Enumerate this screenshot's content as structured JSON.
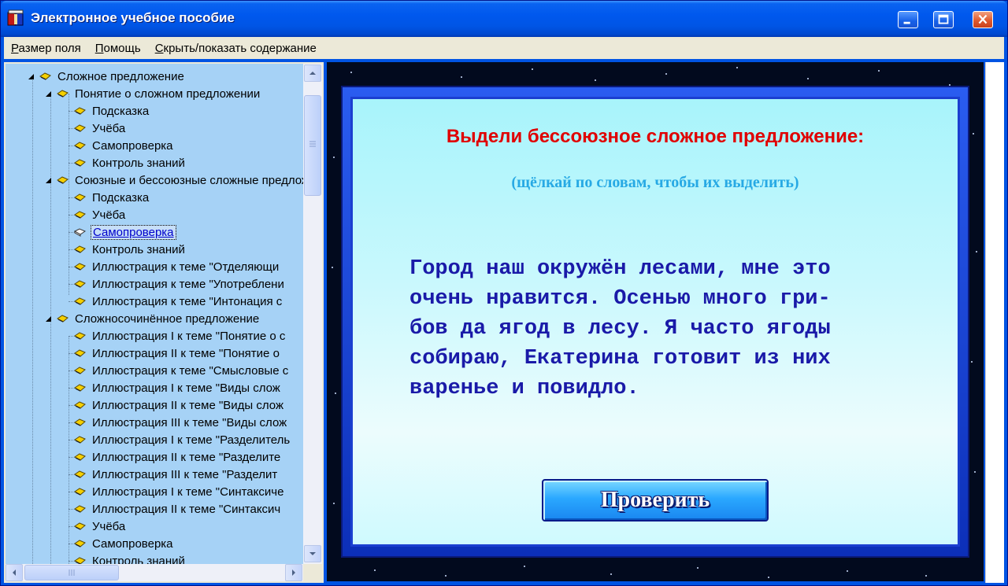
{
  "window": {
    "title": "Электронное учебное пособие",
    "app_icon": "book-app-icon",
    "controls": [
      "minimize-icon",
      "maximize-icon",
      "close-icon"
    ]
  },
  "menu": {
    "items": [
      "Размер поля",
      "Помощь",
      "Скрыть/показать содержание"
    ]
  },
  "tree": {
    "items": [
      {
        "label": "Сложное предложение",
        "level": 0,
        "expanded": true,
        "icon": "chapter-icon"
      },
      {
        "label": "Понятие о сложном предложении",
        "level": 1,
        "expanded": true,
        "icon": "chapter-icon"
      },
      {
        "label": "Подсказка",
        "level": 2,
        "icon": "page-icon"
      },
      {
        "label": "Учёба",
        "level": 2,
        "icon": "page-icon"
      },
      {
        "label": "Самопроверка",
        "level": 2,
        "icon": "page-icon"
      },
      {
        "label": "Контроль знаний",
        "level": 2,
        "icon": "page-icon"
      },
      {
        "label": "Союзные и бессоюзные сложные предложения",
        "level": 1,
        "expanded": true,
        "icon": "chapter-icon"
      },
      {
        "label": "Подсказка",
        "level": 2,
        "icon": "page-icon"
      },
      {
        "label": "Учёба",
        "level": 2,
        "icon": "page-icon"
      },
      {
        "label": "Самопроверка",
        "level": 2,
        "icon": "open-page-icon",
        "selected": true
      },
      {
        "label": "Контроль знаний",
        "level": 2,
        "icon": "page-icon"
      },
      {
        "label": "Иллюстрация к теме \"Отделяющи",
        "level": 2,
        "icon": "page-icon"
      },
      {
        "label": "Иллюстрация к теме \"Употреблени",
        "level": 2,
        "icon": "page-icon"
      },
      {
        "label": "Иллюстрация к теме \"Интонация с",
        "level": 2,
        "icon": "page-icon"
      },
      {
        "label": "Сложносочинённое предложение",
        "level": 1,
        "expanded": true,
        "icon": "chapter-icon"
      },
      {
        "label": "Иллюстрация I к теме \"Понятие о с",
        "level": 2,
        "icon": "page-icon"
      },
      {
        "label": "Иллюстрация II к теме \"Понятие о",
        "level": 2,
        "icon": "page-icon"
      },
      {
        "label": "Иллюстрация к теме \"Смысловые с",
        "level": 2,
        "icon": "page-icon"
      },
      {
        "label": "Иллюстрация I к теме \"Виды слож",
        "level": 2,
        "icon": "page-icon"
      },
      {
        "label": "Иллюстрация II к теме \"Виды слож",
        "level": 2,
        "icon": "page-icon"
      },
      {
        "label": "Иллюстрация III к теме \"Виды слож",
        "level": 2,
        "icon": "page-icon"
      },
      {
        "label": "Иллюстрация I к теме \"Разделитель",
        "level": 2,
        "icon": "page-icon"
      },
      {
        "label": "Иллюстрация II к теме \"Разделите",
        "level": 2,
        "icon": "page-icon"
      },
      {
        "label": "Иллюстрация III к теме \"Разделит",
        "level": 2,
        "icon": "page-icon"
      },
      {
        "label": "Иллюстрация I к теме \"Синтаксиче",
        "level": 2,
        "icon": "page-icon"
      },
      {
        "label": "Иллюстрация II к теме \"Синтаксич",
        "level": 2,
        "icon": "page-icon"
      },
      {
        "label": "Учёба",
        "level": 2,
        "icon": "page-icon"
      },
      {
        "label": "Самопроверка",
        "level": 2,
        "icon": "page-icon"
      },
      {
        "label": "Контроль знаний",
        "level": 2,
        "icon": "page-icon"
      }
    ]
  },
  "exercise": {
    "title": "Выдели бессоюзное сложное предложение:",
    "hint": "(щёлкай по словам, чтобы их выделить)",
    "words_lines": [
      "Город наш окружён лесами, мне это",
      "очень нравится. Осенью много гри-",
      "бов да ягод в лесу. Я часто ягоды",
      "собираю, Екатерина готовит из них",
      "варенье и повидло."
    ],
    "check_label": "Проверить"
  },
  "colors": {
    "title_red": "#e00000",
    "hint_blue": "#27a9e4",
    "text_blue": "#1a1aa8",
    "tree_bg": "#a6d2f6"
  }
}
